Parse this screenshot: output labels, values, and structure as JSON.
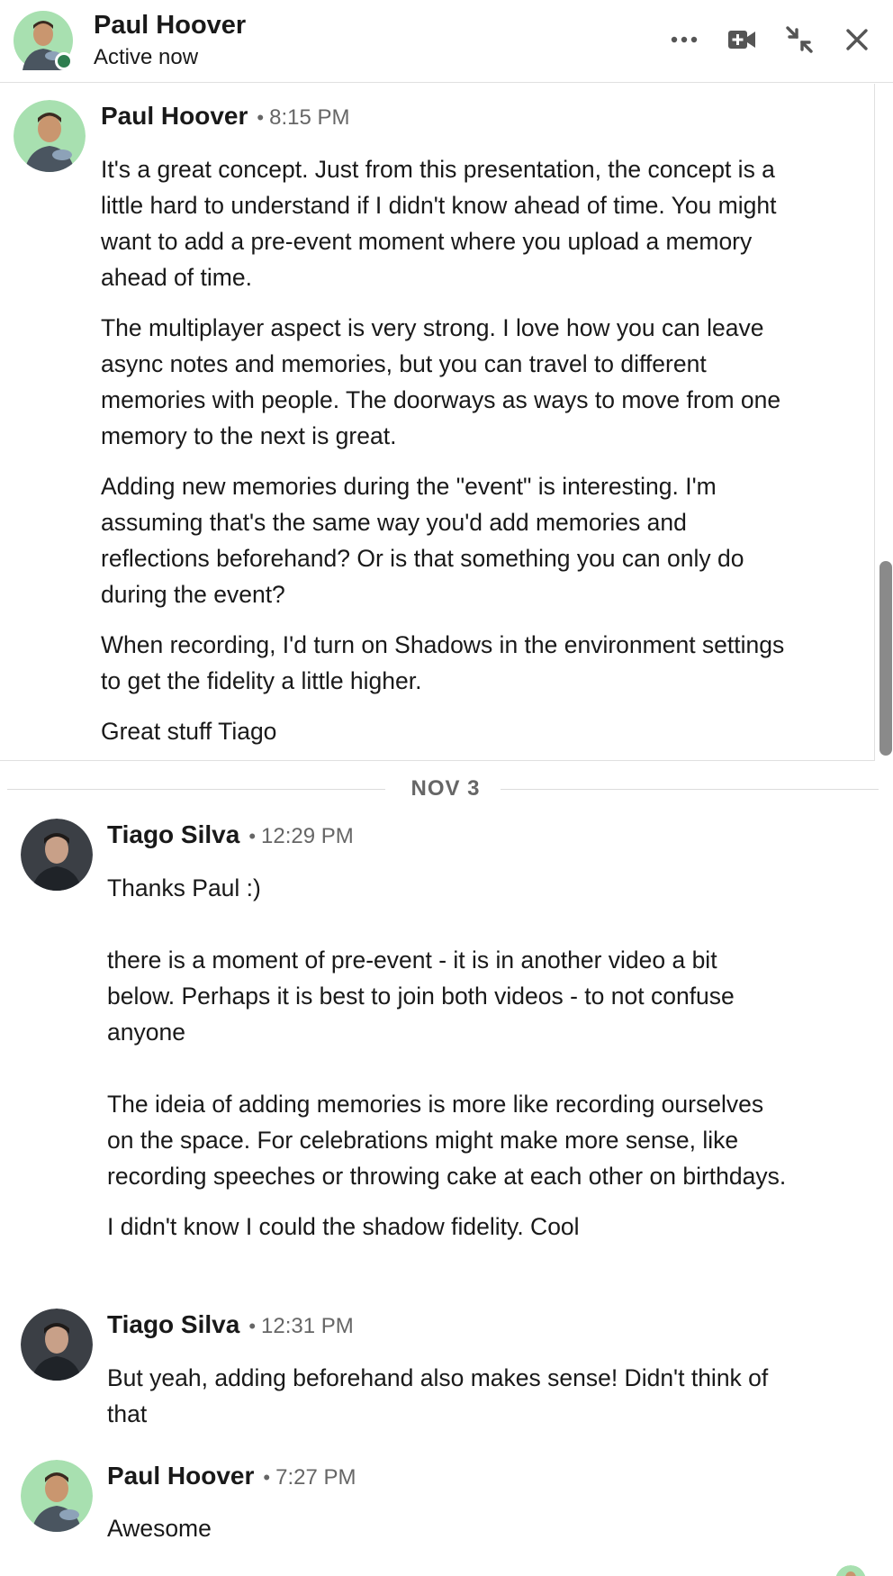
{
  "header": {
    "name": "Paul Hoover",
    "status": "Active now"
  },
  "messages": [
    {
      "sender": "Paul Hoover",
      "time": "8:15 PM",
      "paragraphs": [
        "It's a great concept. Just from this presentation, the concept is a little hard to understand if I didn't know ahead of time. You might want to add a pre-event moment where you upload a memory ahead of time.",
        "The multiplayer aspect is very strong. I love how you can leave async notes and memories, but you can travel to different memories with people. The doorways as ways to move from one memory to the next is great.",
        "Adding new memories during the \"event\" is interesting. I'm assuming that's the same way you'd add memories and reflections beforehand? Or is that something you can only do during the event?",
        "When recording, I'd turn on Shadows in the environment settings to get the fidelity a little higher.",
        "Great stuff Tiago"
      ]
    },
    {
      "sender": "Tiago Silva",
      "time": "12:29 PM",
      "paragraphs": [
        "Thanks Paul :)",
        "there is a moment of pre-event - it is in another video a bit below. Perhaps it is best to join both videos - to not confuse anyone",
        "The ideia of adding memories is more like recording ourselves on the space. For celebrations might make more sense, like recording speeches or throwing cake at each other on birthdays.",
        "I didn't know I could the shadow fidelity. Cool"
      ]
    },
    {
      "sender": "Tiago Silva",
      "time": "12:31 PM",
      "paragraphs": [
        "But yeah, adding beforehand also makes sense! Didn't think of that"
      ]
    },
    {
      "sender": "Paul Hoover",
      "time": "7:27 PM",
      "paragraphs": [
        "Awesome"
      ]
    }
  ],
  "date_separator": "NOV 3",
  "dot": "•",
  "colors": {
    "presence": "#2e7d4f",
    "avatar_bg_paul": "#a8e0b0",
    "text": "#191919",
    "muted": "#666666"
  },
  "icons": [
    "more-options-icon",
    "video-call-icon",
    "minimize-icon",
    "close-icon"
  ]
}
